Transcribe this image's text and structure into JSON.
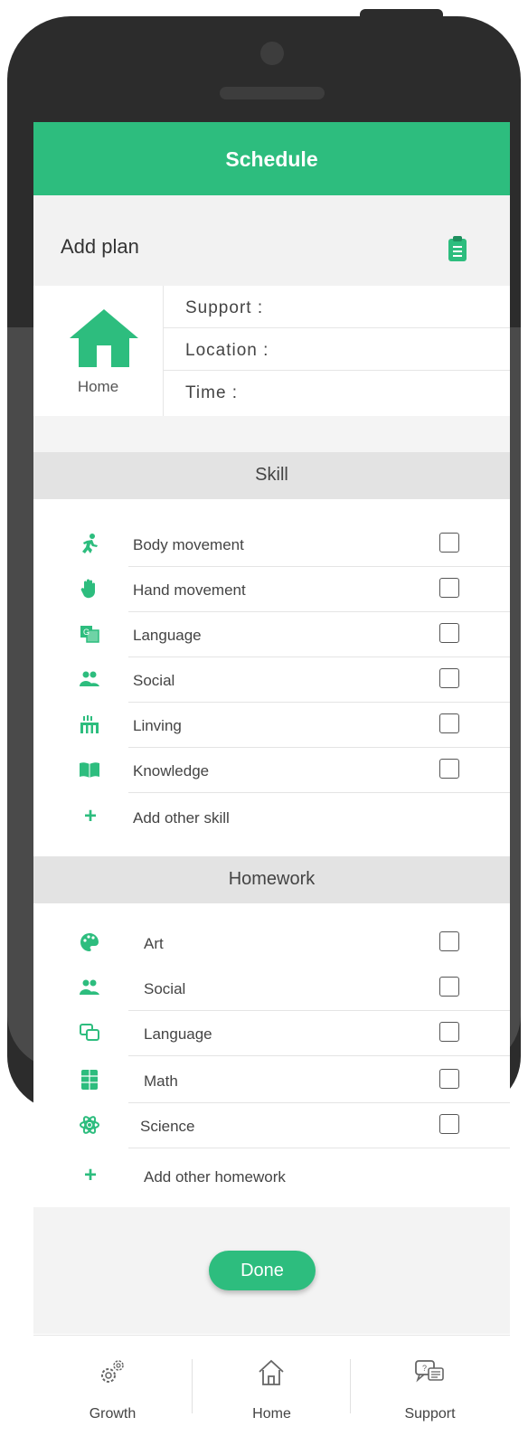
{
  "header": {
    "title": "Schedule"
  },
  "plan": {
    "title": "Add plan",
    "location_label": "Home",
    "fields": [
      "Support :",
      "Location :",
      "Time :"
    ]
  },
  "skill": {
    "title": "Skill",
    "items": [
      {
        "label": "Body movement",
        "icon": "running-person-icon"
      },
      {
        "label": "Hand movement",
        "icon": "hand-icon"
      },
      {
        "label": "Language",
        "icon": "translate-icon"
      },
      {
        "label": "Social",
        "icon": "people-icon"
      },
      {
        "label": "Linving",
        "icon": "living-icon"
      },
      {
        "label": "Knowledge",
        "icon": "book-icon"
      }
    ],
    "add_label": "Add other skill"
  },
  "homework": {
    "title": "Homework",
    "items": [
      {
        "label": "Art",
        "icon": "palette-icon"
      },
      {
        "label": "Social",
        "icon": "people-icon"
      },
      {
        "label": "Language",
        "icon": "translate-icon"
      },
      {
        "label": "Math",
        "icon": "calculator-icon"
      },
      {
        "label": "Science",
        "icon": "atom-icon"
      }
    ],
    "add_label": "Add other homework"
  },
  "done_label": "Done",
  "nav": [
    {
      "label": "Growth",
      "icon": "gears-icon"
    },
    {
      "label": "Home",
      "icon": "home-icon"
    },
    {
      "label": "Support",
      "icon": "chat-icon"
    }
  ],
  "colors": {
    "accent": "#2dbd7e",
    "phone": "#2c2c2c"
  }
}
